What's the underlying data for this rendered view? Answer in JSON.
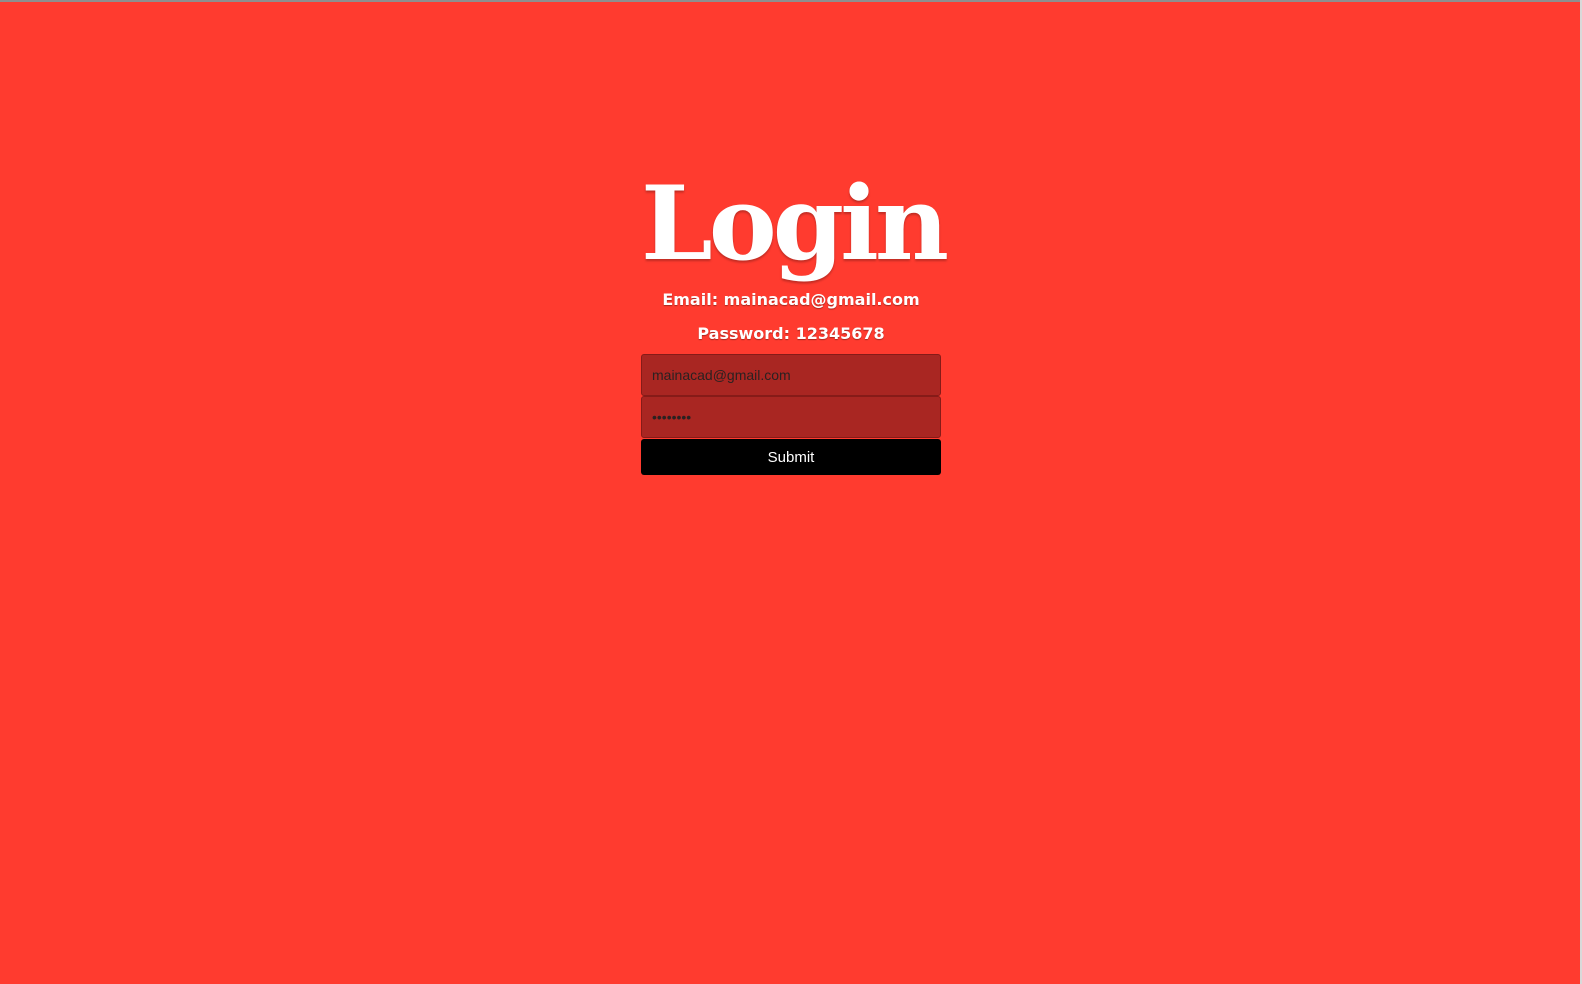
{
  "colors": {
    "background": "#ff3b2f",
    "field_background": "#a92622",
    "button_background": "#000000",
    "text": "#ffffff"
  },
  "login": {
    "title": "Login",
    "email_hint": "Email: mainacad@gmail.com",
    "password_hint": "Password: 12345678",
    "email_value": "mainacad@gmail.com",
    "password_value": "12345678",
    "submit_label": "Submit"
  }
}
